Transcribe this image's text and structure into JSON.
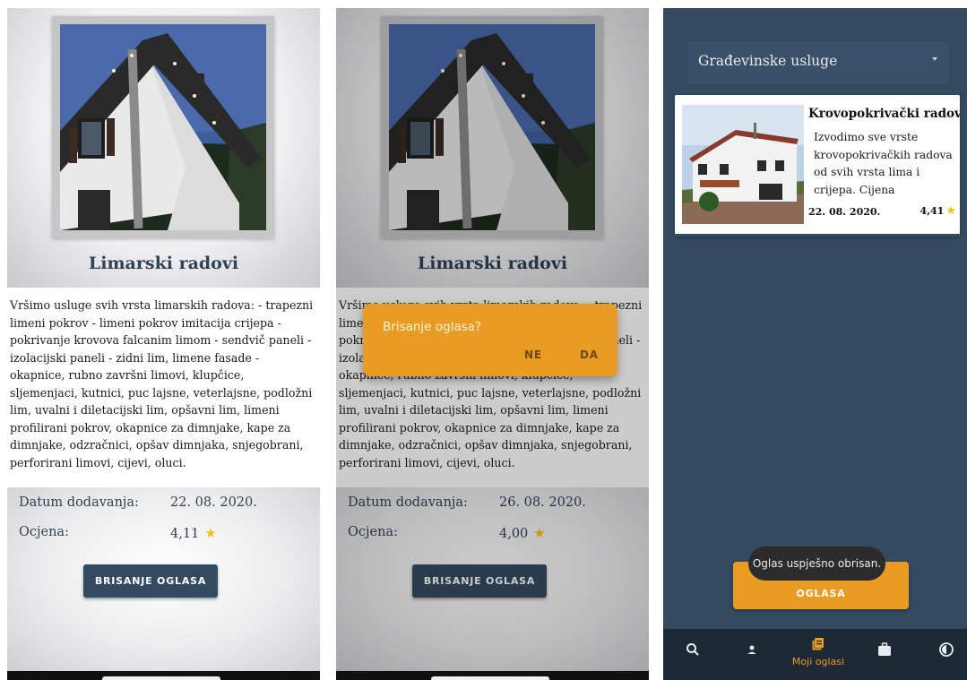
{
  "detail": {
    "title": "Limarski radovi",
    "description": "Vršimo usluge svih vrsta limarskih radova: - trapezni limeni pokrov - limeni pokrov imitacija crijepa - pokrivanje krovova falcanim limom - sendvič paneli - izolacijski paneli - zidni lim, limene fasade - okapnice, rubno završni limovi, klupčice, sljemenjaci, kutnici, puc lajsne, veterlajsne, podložni lim, uvalni i diletacijski lim, opšavni lim, limeni profilirani pokrov, okapnice za dimnjake, kape za dimnjake, odzračnici, opšav dimnjaka, snjegobrani, perforirani limovi, cijevi, oluci.",
    "date_label": "Datum dodavanja:",
    "rating_label": "Ocjena:",
    "delete_button": "BRISANJE OGLASA",
    "star_icon": "★"
  },
  "screen1": {
    "date": "22. 08. 2020.",
    "rating": "4,11"
  },
  "screen2": {
    "date": "26. 08. 2020.",
    "rating": "4,00",
    "dialog": {
      "message": "Brisanje oglasa?",
      "no": "NE",
      "yes": "DA"
    }
  },
  "screen3": {
    "category": "Građevinske usluge",
    "card": {
      "title": "Krovopokrivački radov",
      "description": "Izvodimo sve vrste krovopokrivačkih radova od svih vrsta lima i crijepa.  Cijena",
      "date": "22. 08. 2020.",
      "rating": "4,41"
    },
    "button_label": "OGLASA",
    "toast": "Oglas uspješno obrisan.",
    "nav": {
      "active_label": "Moji oglasi"
    }
  },
  "colors": {
    "primary": "#344a60",
    "accent": "#e89c24",
    "nav_bg": "#1d2a36",
    "star": "#f1c40f"
  },
  "icons": [
    "search-icon",
    "person-icon",
    "my-ads-icon",
    "briefcase-icon",
    "theme-icon",
    "star-icon",
    "dropdown-arrow-icon"
  ]
}
